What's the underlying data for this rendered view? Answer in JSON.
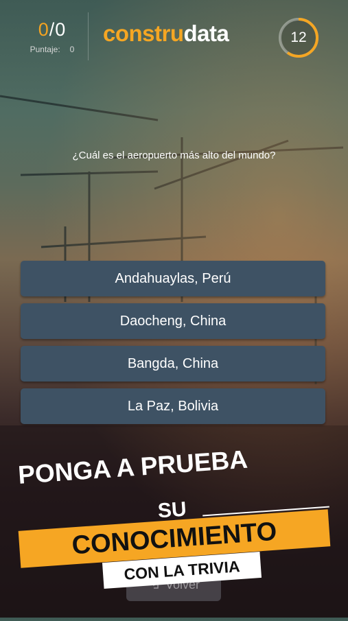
{
  "header": {
    "score_current": "0",
    "score_total": "0",
    "score_label": "Puntaje:",
    "score_value": "0",
    "logo_part1": "constru",
    "logo_part2": "data",
    "timer_value": "12",
    "timer_fraction_remaining": 0.6
  },
  "question": "¿Cuál es el aeropuerto más alto del mundo?",
  "answers": [
    "Andahuaylas, Perú",
    "Daocheng, China",
    "Bangda, China",
    "La Paz, Bolivia"
  ],
  "back_button": {
    "label": "Volver",
    "icon": "back-arrow-icon"
  },
  "promo": {
    "line1": "PONGA A PRUEBA",
    "line2": "SU",
    "line3": "CONOCIMIENTO",
    "line4": "CON LA TRIVIA"
  },
  "colors": {
    "accent": "#f5a623",
    "answer_bg": "#3e5264"
  }
}
